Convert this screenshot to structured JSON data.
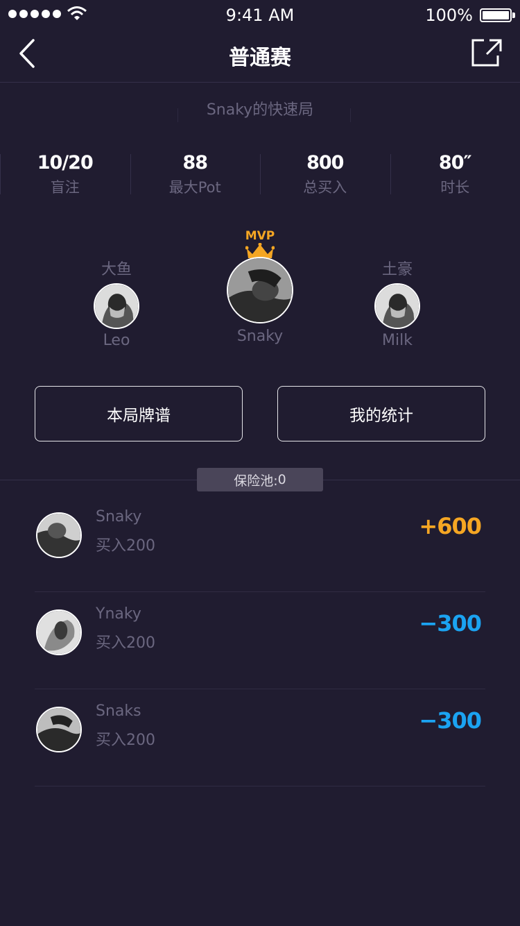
{
  "status_bar": {
    "time": "9:41 AM",
    "battery": "100%"
  },
  "nav": {
    "title": "普通赛"
  },
  "game": {
    "name": "Snaky的快速局"
  },
  "stats": [
    {
      "value": "10/20",
      "label": "盲注"
    },
    {
      "value": "88",
      "label": "最大Pot"
    },
    {
      "value": "800",
      "label": "总买入"
    },
    {
      "value": "80″",
      "label": "时长"
    }
  ],
  "podium": {
    "left": {
      "title": "大鱼",
      "name": "Leo"
    },
    "center": {
      "badge": "MVP",
      "name": "Snaky"
    },
    "right": {
      "title": "土豪",
      "name": "Milk"
    }
  },
  "buttons": {
    "hand_history": "本局牌谱",
    "my_stats": "我的统计"
  },
  "insurance_pool": {
    "label": "保险池:",
    "value": "0"
  },
  "results": [
    {
      "name": "Snaky",
      "buyin": "买入200",
      "score_sign": "+",
      "score": "600",
      "color": "#f5a623"
    },
    {
      "name": "Ynaky",
      "buyin": "买入200",
      "score_sign": "−",
      "score": "300",
      "color": "#1ba3f1"
    },
    {
      "name": "Snaks",
      "buyin": "买入200",
      "score_sign": "−",
      "score": "300",
      "color": "#1ba3f1"
    }
  ],
  "colors": {
    "background": "#201c30",
    "win": "#f5a623",
    "loss": "#1ba3f1",
    "muted": "#6b6780"
  }
}
